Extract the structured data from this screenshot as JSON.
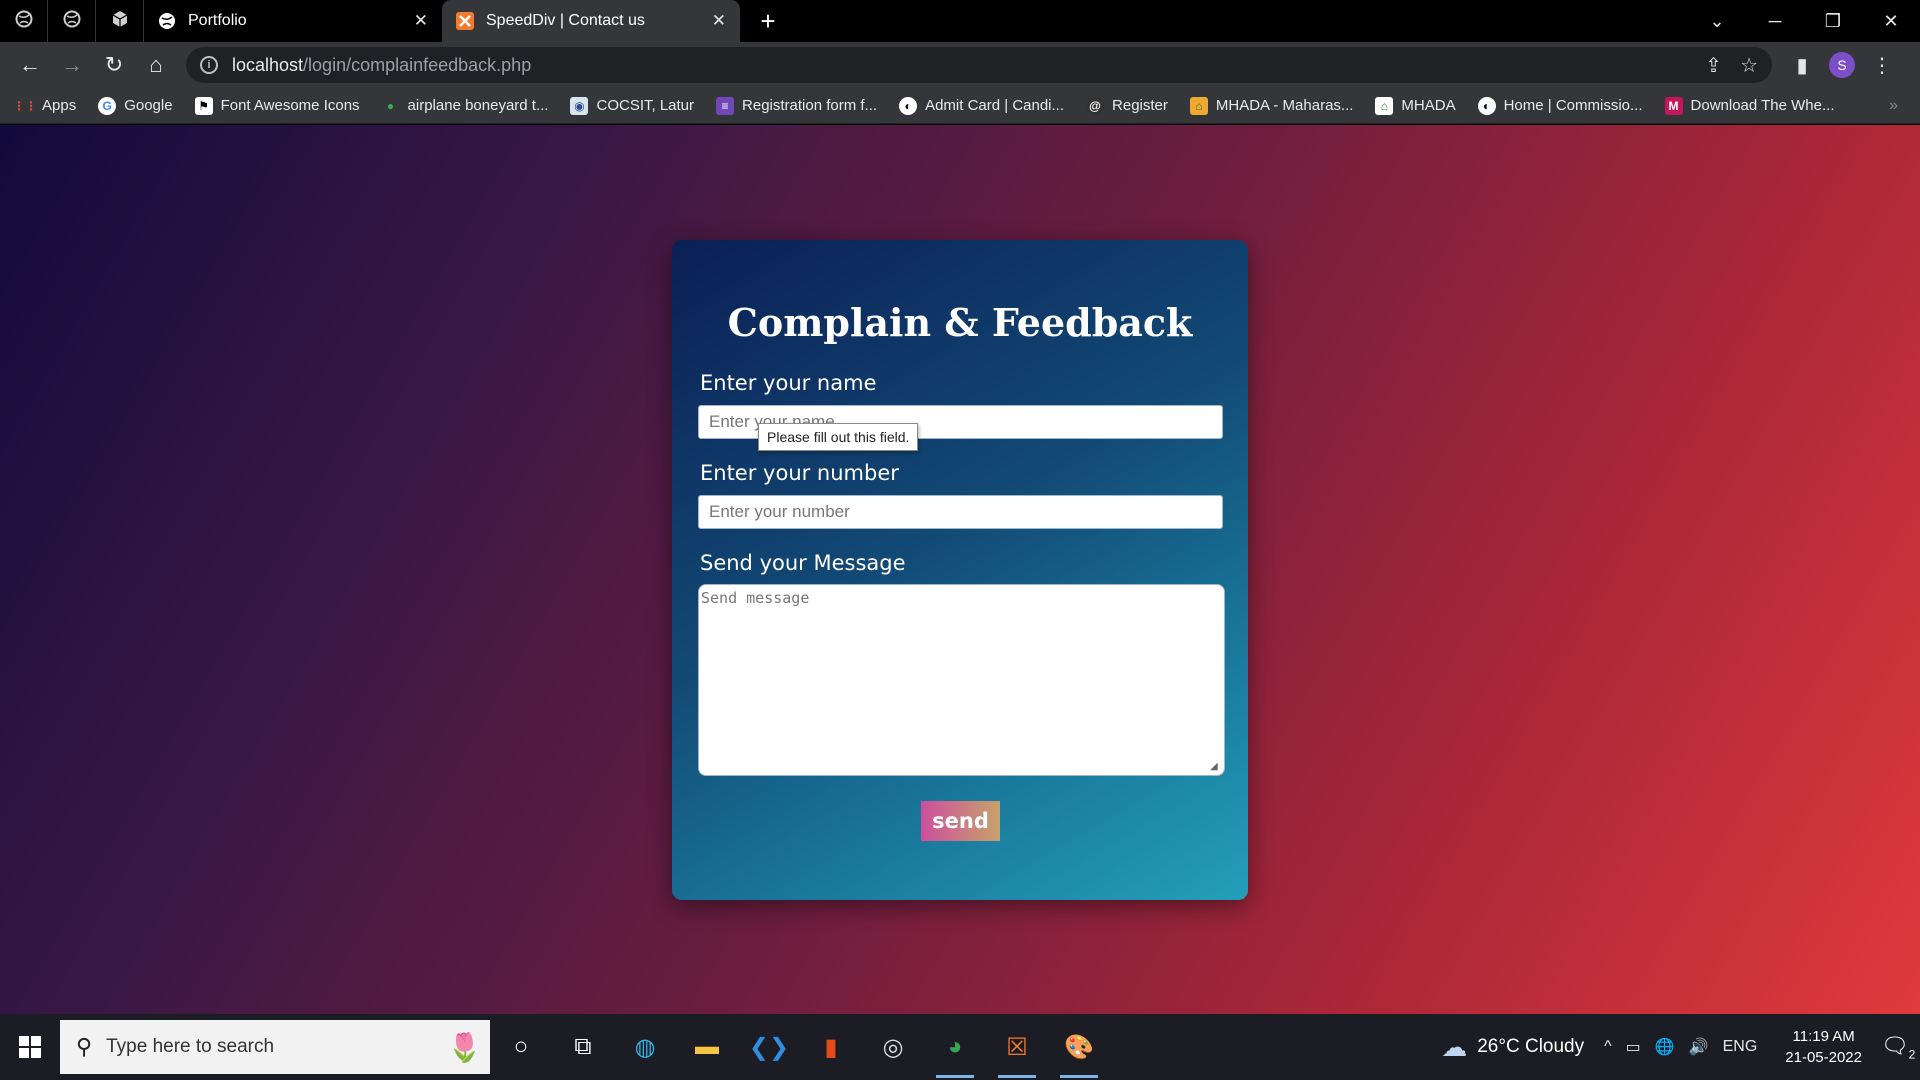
{
  "browser": {
    "tabs": [
      {
        "label": "Portfolio",
        "active": false
      },
      {
        "label": "SpeedDiv | Contact us",
        "active": true
      }
    ],
    "url_host": "localhost",
    "url_path": "/login/complainfeedback.php",
    "profile_initial": "S",
    "bookmarks": [
      "Apps",
      "Google",
      "Font Awesome Icons",
      "airplane boneyard t...",
      "COCSIT, Latur",
      "Registration form f...",
      "Admit Card | Candi...",
      "Register",
      "MHADA - Maharas...",
      "MHADA",
      "Home | Commissio...",
      "Download The Whe..."
    ]
  },
  "form": {
    "title": "Complain & Feedback",
    "name_label": "Enter your name",
    "name_placeholder": "Enter your name",
    "number_label": "Enter your number",
    "number_placeholder": "Enter your number",
    "message_label": "Send your Message",
    "message_placeholder": "Send message",
    "send_label": "send",
    "validation_tooltip": "Please fill out this field."
  },
  "taskbar": {
    "search_placeholder": "Type here to search",
    "weather": "26°C  Cloudy",
    "language": "ENG",
    "time": "11:19 AM",
    "date": "21-05-2022",
    "notification_count": "2"
  },
  "colors": {
    "page_gradient_start": "#120a3c",
    "page_gradient_end": "#e03a3c",
    "card_gradient_start": "#0b1f55",
    "card_gradient_end": "#239fba",
    "send_gradient_start": "#cc4f9c",
    "send_gradient_end": "#c8a26a"
  }
}
